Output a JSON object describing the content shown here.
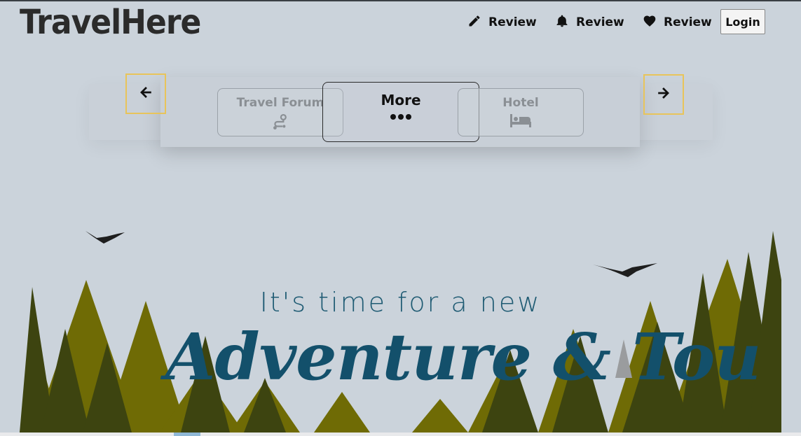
{
  "brand": {
    "logo_text": "TravelHere"
  },
  "nav": {
    "items": [
      {
        "label": "Review",
        "icon": "pencil-icon"
      },
      {
        "label": "Review",
        "icon": "bell-icon"
      },
      {
        "label": "Review",
        "icon": "heart-icon"
      }
    ],
    "login_label": "Login"
  },
  "carousel": {
    "prev_icon": "arrow-left-icon",
    "next_icon": "arrow-right-icon",
    "cards": [
      {
        "label": "Travel Forum",
        "icon": "route-icon",
        "state": "dimmed"
      },
      {
        "label": "More",
        "icon": "ellipsis-icon",
        "state": "active"
      },
      {
        "label": "Hotel",
        "icon": "bed-icon",
        "state": "dimmed"
      }
    ]
  },
  "hero": {
    "tagline": "It's time for a new",
    "headline": "Adventure & Tou"
  },
  "colors": {
    "background": "#cbd3db",
    "arrow_border": "#e8c45a",
    "headline": "#13506b",
    "tree_light": "#6f6b05",
    "tree_dark": "#3d4410"
  }
}
